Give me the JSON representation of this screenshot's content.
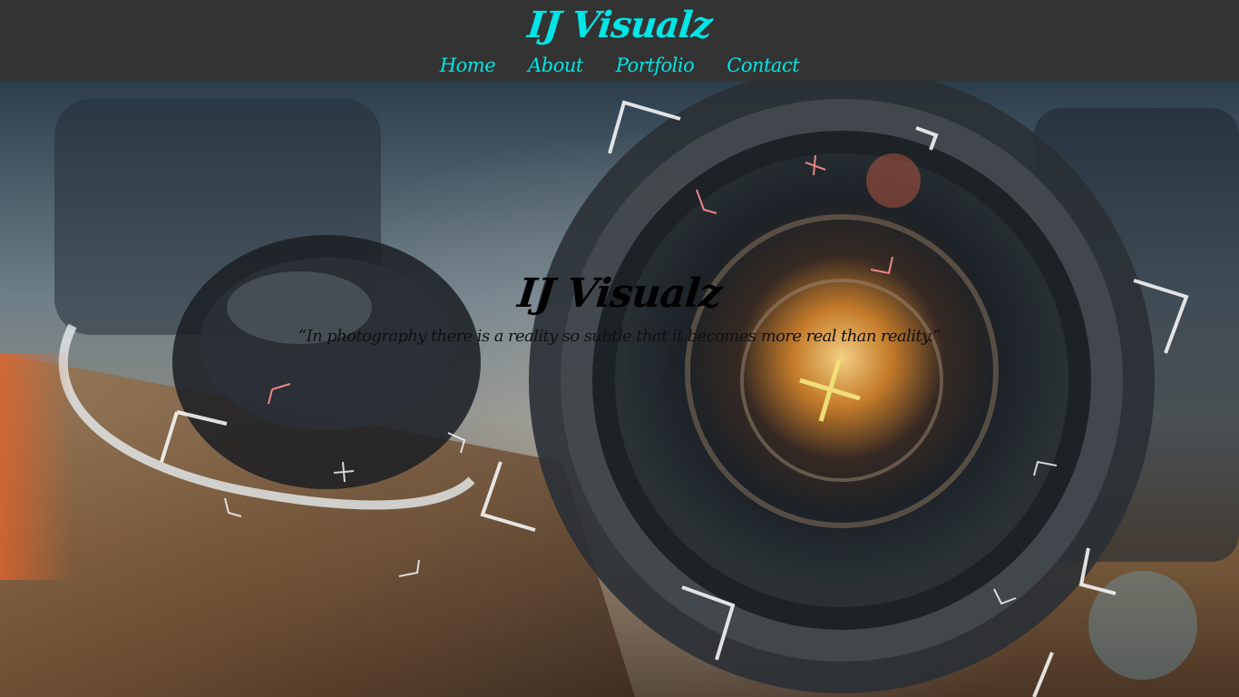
{
  "header": {
    "brand": "IJ Visualz",
    "nav": [
      {
        "label": "Home"
      },
      {
        "label": "About"
      },
      {
        "label": "Portfolio"
      },
      {
        "label": "Contact"
      }
    ]
  },
  "hero": {
    "title": "IJ Visualz",
    "quote": "“In photography there is a reality so subtle that it becomes more real than reality.”"
  },
  "colors": {
    "header_bg": "#333333",
    "accent": "#00e5e5",
    "hero_text": "#000000"
  }
}
